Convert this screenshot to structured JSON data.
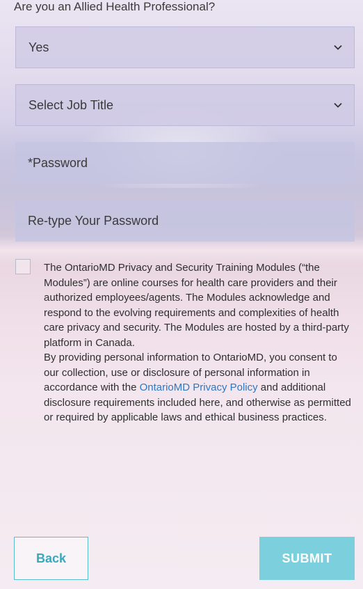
{
  "allied_health": {
    "question": "Are you an Allied Health Professional?",
    "selected": "Yes"
  },
  "job_title": {
    "selected": "Select Job Title"
  },
  "password": {
    "placeholder": "*Password"
  },
  "retype_password": {
    "placeholder": "Re-type Your Password"
  },
  "consent": {
    "paragraph1": "The OntarioMD Privacy and Security Training Modules (“the Modules”) are online courses for health care providers and their authorized employees/agents. The Modules acknowledge and respond to the evolving requirements and complexities of health care privacy and security. The Modules are hosted by a third-party platform in Canada.",
    "paragraph2_before_link": "By providing personal information to OntarioMD, you consent to our collection, use or disclosure of personal information in accordance with the ",
    "link_text": "OntarioMD Privacy Policy",
    "paragraph2_after_link": " and additional disclosure requirements included here, and otherwise as permitted or required by applicable laws and ethical business practices."
  },
  "buttons": {
    "back": "Back",
    "submit": "SUBMIT"
  },
  "colors": {
    "accent": "#3aa8bb",
    "submit_bg": "#7ccfdd",
    "link": "#2f78c2"
  },
  "icons": {
    "dropdown": "chevron-down-icon"
  }
}
